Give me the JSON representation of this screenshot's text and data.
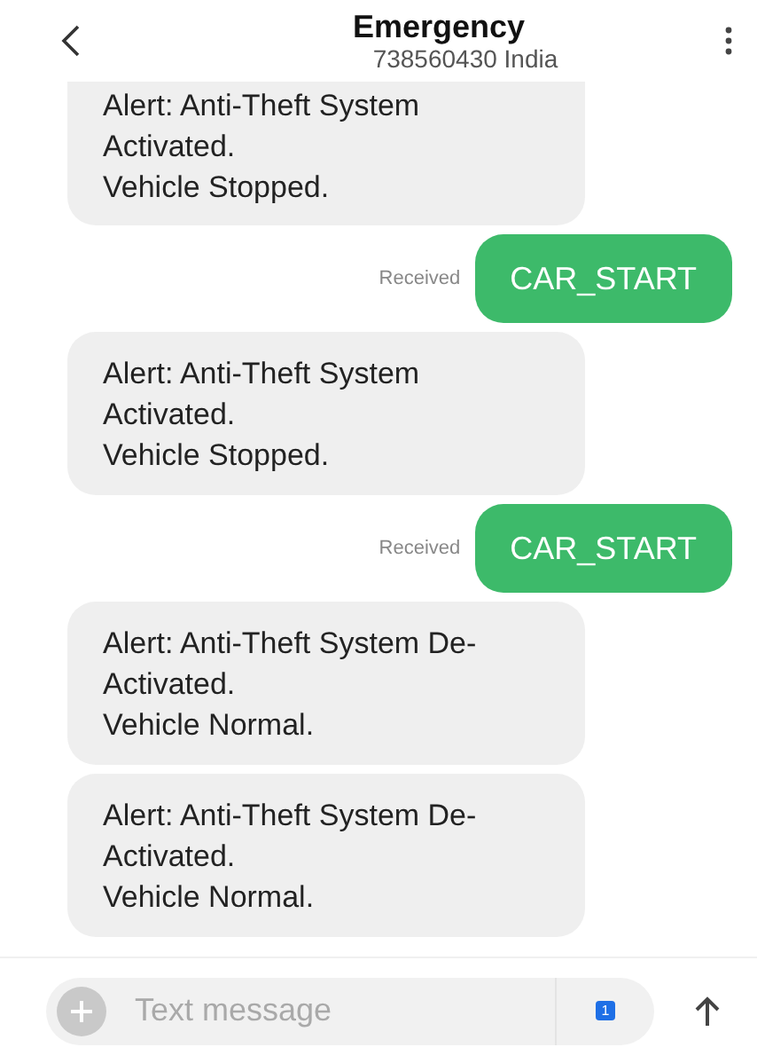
{
  "header": {
    "title": "Emergency",
    "subtitle": "738560430 India"
  },
  "messages": [
    {
      "kind": "incoming",
      "cut": true,
      "lines": [
        "Alert: Anti-Theft System",
        "Activated.",
        "Vehicle Stopped."
      ]
    },
    {
      "kind": "outgoing",
      "status": "Received",
      "lines": [
        "CAR_START"
      ]
    },
    {
      "kind": "incoming",
      "cut": false,
      "lines": [
        "Alert: Anti-Theft System",
        "Activated.",
        "Vehicle Stopped."
      ]
    },
    {
      "kind": "outgoing",
      "status": "Received",
      "lines": [
        "CAR_START"
      ]
    },
    {
      "kind": "incoming",
      "cut": false,
      "lines": [
        "Alert: Anti-Theft System De-",
        "Activated.",
        "Vehicle Normal."
      ]
    },
    {
      "kind": "incoming",
      "cut": false,
      "lines": [
        "Alert: Anti-Theft System De-",
        "Activated.",
        "Vehicle Normal."
      ]
    }
  ],
  "composer": {
    "placeholder": "Text message",
    "sim": "1"
  }
}
